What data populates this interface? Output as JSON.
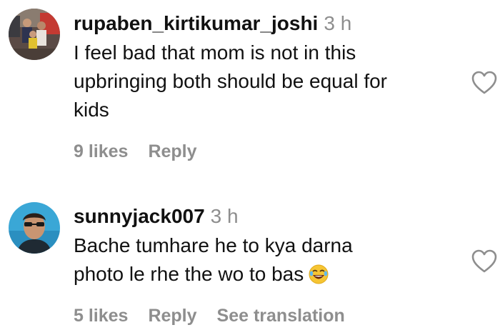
{
  "comments": [
    {
      "username": "rupaben_kirtikumar_joshi",
      "time": "3 h",
      "lines": [
        "I feel bad that mom is not in this",
        "upbringing both should be equal for",
        "kids"
      ],
      "likes": "9 likes",
      "reply": "Reply",
      "avatar_icon": "family-photo-avatar",
      "like_icon": "heart-outline-icon"
    },
    {
      "username": "sunnyjack007",
      "time": "3 h",
      "lines": [
        "Bache tumhare he to kya darna",
        "photo le rhe the wo to bas"
      ],
      "emoji": "😂",
      "likes": "5 likes",
      "reply": "Reply",
      "see_translation": "See translation",
      "avatar_icon": "selfie-photo-avatar",
      "like_icon": "heart-outline-icon"
    }
  ],
  "colors": {
    "text": "#111111",
    "muted": "#8e8e8e",
    "background": "#ffffff"
  }
}
